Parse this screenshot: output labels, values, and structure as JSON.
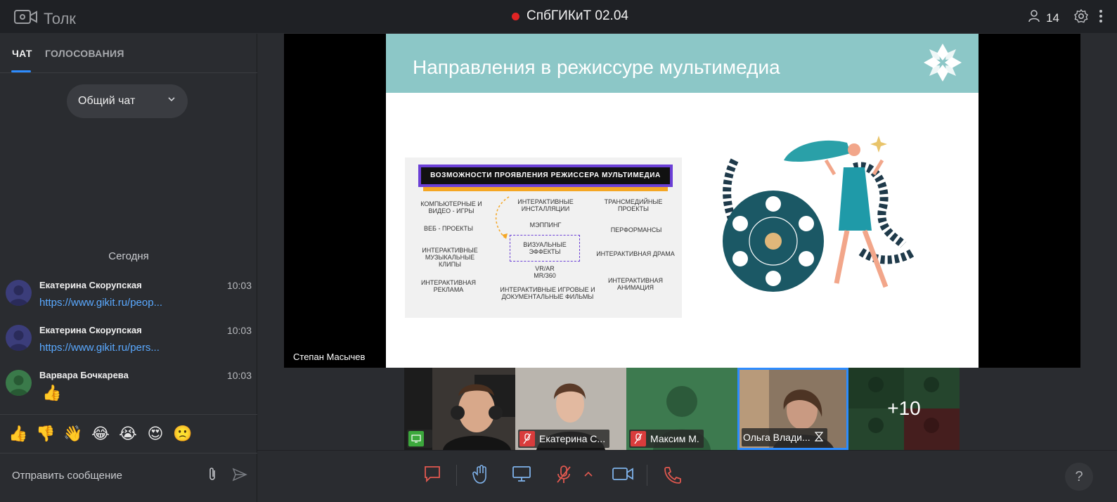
{
  "app": {
    "name": "Толк"
  },
  "meeting": {
    "title": "СпбГИКиТ 02.04",
    "participants_count": "14"
  },
  "sidebar": {
    "tabs": [
      {
        "label": "ЧАТ"
      },
      {
        "label": "ГОЛОСОВАНИЯ"
      }
    ],
    "chat_selector": "Общий чат",
    "date_separator": "Сегодня",
    "messages": [
      {
        "author": "Екатерина Скорупская",
        "time": "10:03",
        "text": "https://www.gikit.ru/peop..."
      },
      {
        "author": "Екатерина Скорупская",
        "time": "10:03",
        "text": "https://www.gikit.ru/pers..."
      },
      {
        "author": "Варвара Бочкарева",
        "time": "10:03",
        "text": "👍"
      }
    ],
    "reactions": [
      "👍",
      "👎",
      "👋",
      "😂",
      "😭",
      "😍",
      "🙁"
    ],
    "composer_placeholder": "Отправить сообщение"
  },
  "stage": {
    "presenter_name": "Степан Масычев",
    "slide": {
      "title": "Направления в режиссуре мультимедиа",
      "banner": "ВОЗМОЖНОСТИ ПРОЯВЛЕНИЯ РЕЖИССЕРА МУЛЬТИМЕДИА",
      "items": [
        "КОМПЬЮТЕРНЫЕ И ВИДЕО - ИГРЫ",
        "ИНТЕРАКТИВНЫЕ ИНСТАЛЛЯЦИИ",
        "ТРАНСМЕДИЙНЫЕ ПРОЕКТЫ",
        "ВЕБ - ПРОЕКТЫ",
        "МЭППИНГ",
        "ПЕРФОРМАНСЫ",
        "ИНТЕРАКТИВНЫЕ МУЗЫКАЛЬНЫЕ КЛИПЫ",
        "ВИЗУАЛЬНЫЕ ЭФФЕКТЫ",
        "ИНТЕРАКТИВНАЯ ДРАМА",
        "VR/AR MR/360",
        "ИНТЕРАКТИВНАЯ РЕКЛАМА",
        "ИНТЕРАКТИВНЫЕ ИГРОВЫЕ И ДОКУМЕНТАЛЬНЫЕ ФИЛЬМЫ",
        "ИНТЕРАКТИВНАЯ АНИМАЦИЯ"
      ]
    }
  },
  "participants": [
    {
      "name": "",
      "status": "screen-share"
    },
    {
      "name": "Екатерина С...",
      "status": "mic-off"
    },
    {
      "name": "Максим М.",
      "status": "mic-off"
    },
    {
      "name": "Ольга Влади...",
      "status": "waiting"
    }
  ],
  "more_participants": "+10",
  "toolbar": {
    "help_label": "?"
  },
  "colors": {
    "accent": "#2d8cff",
    "recording": "#e02424",
    "danger": "#d93c3c",
    "link": "#5aa9ff",
    "slide_header": "#8cc7c7"
  }
}
